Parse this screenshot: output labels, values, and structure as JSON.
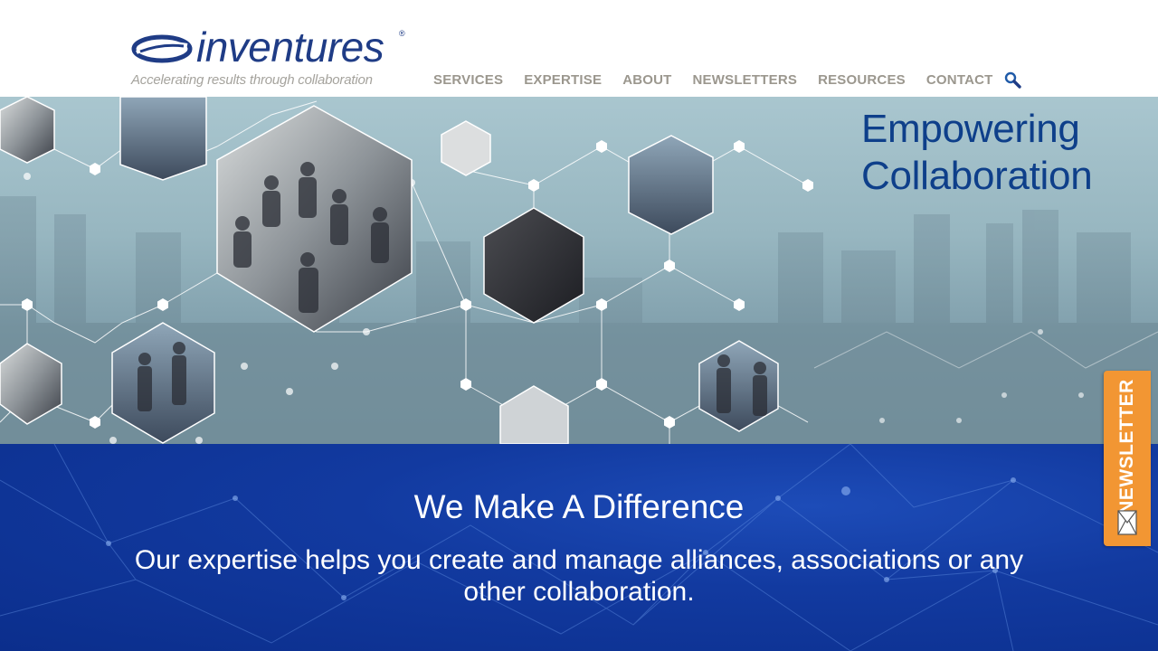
{
  "brand": {
    "name": "inventures",
    "registered_mark": "®",
    "tagline": "Accelerating results through collaboration",
    "color": "#1f3c86"
  },
  "nav": {
    "items": [
      {
        "label": "SERVICES"
      },
      {
        "label": "EXPERTISE"
      },
      {
        "label": "ABOUT"
      },
      {
        "label": "NEWSLETTERS"
      },
      {
        "label": "RESOURCES"
      },
      {
        "label": "CONTACT"
      }
    ],
    "search_icon": "search-icon"
  },
  "hero": {
    "title_line1": "Empowering",
    "title_line2": "Collaboration",
    "title_color": "#0e3f8a"
  },
  "band": {
    "title": "We Make A Difference",
    "text": "Our expertise helps you create and manage alliances, associations or any other collaboration.",
    "background": "#0b2e8c"
  },
  "newsletter_tab": {
    "label": "NEWSLETTER",
    "icon": "envelope-icon",
    "color": "#f29633"
  }
}
